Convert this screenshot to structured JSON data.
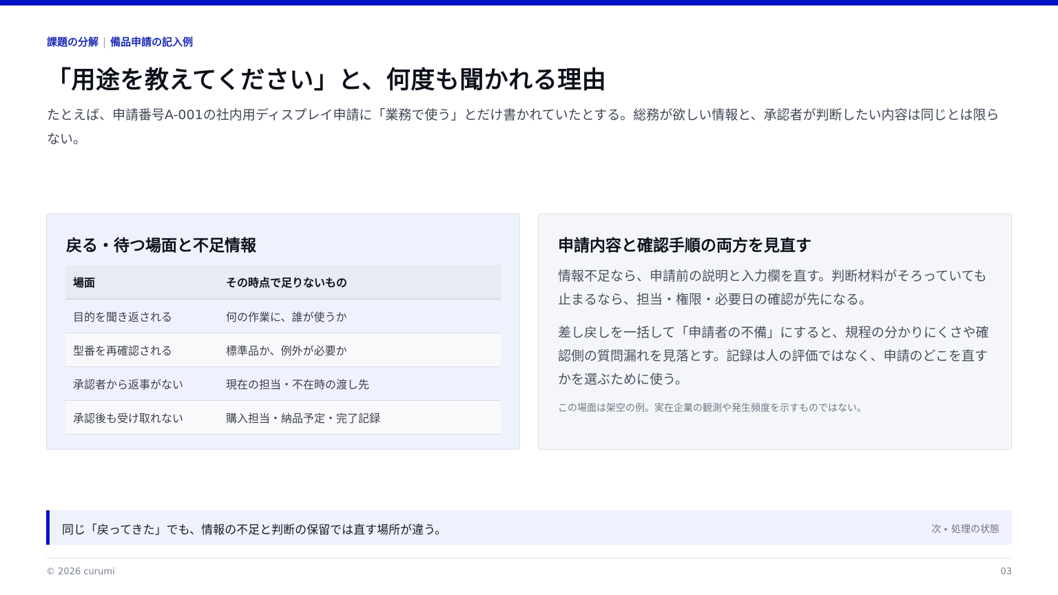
{
  "eyebrow": {
    "section": "課題の分解",
    "separator": "|",
    "topic": "備品申請の記入例"
  },
  "title": "「用途を教えてください」と、何度も聞かれる理由",
  "lead": "たとえば、申請番号A-001の社内用ディスプレイ申請に「業務で使う」とだけ書かれていたとする。総務が欲しい情報と、承認者が判断したい内容は同じとは限らない。",
  "left_card": {
    "title": "戻る・待つ場面と不足情報",
    "headers": [
      "場面",
      "その時点で足りないもの"
    ],
    "rows": [
      [
        "目的を聞き返される",
        "何の作業に、誰が使うか"
      ],
      [
        "型番を再確認される",
        "標準品か、例外が必要か"
      ],
      [
        "承認者から返事がない",
        "現在の担当・不在時の渡し先"
      ],
      [
        "承認後も受け取れない",
        "購入担当・納品予定・完了記録"
      ]
    ]
  },
  "right_card": {
    "title": "申請内容と確認手順の両方を見直す",
    "paragraph1": "情報不足なら、申請前の説明と入力欄を直す。判断材料がそろっていても止まるなら、担当・権限・必要日の確認が先になる。",
    "paragraph2": "差し戻しを一括して「申請者の不備」にすると、規程の分かりにくさや確認側の質問漏れを見落とす。記録は人の評価ではなく、申請のどこを直すかを選ぶために使う。",
    "note": "この場面は架空の例。実在企業の観測や発生頻度を示すものではない。"
  },
  "callout": {
    "text": "同じ「戻ってきた」でも、情報の不足と判断の保留では直す場所が違う。",
    "next_label": "次",
    "next_arrow": "▸",
    "next_topic": "処理の状態"
  },
  "footer": {
    "copyright": "© 2026 curumi",
    "page": "03"
  },
  "colors": {
    "accent": "#0013c4",
    "card_left_bg": "#eef2fd",
    "card_right_bg": "#f5f6fa"
  }
}
